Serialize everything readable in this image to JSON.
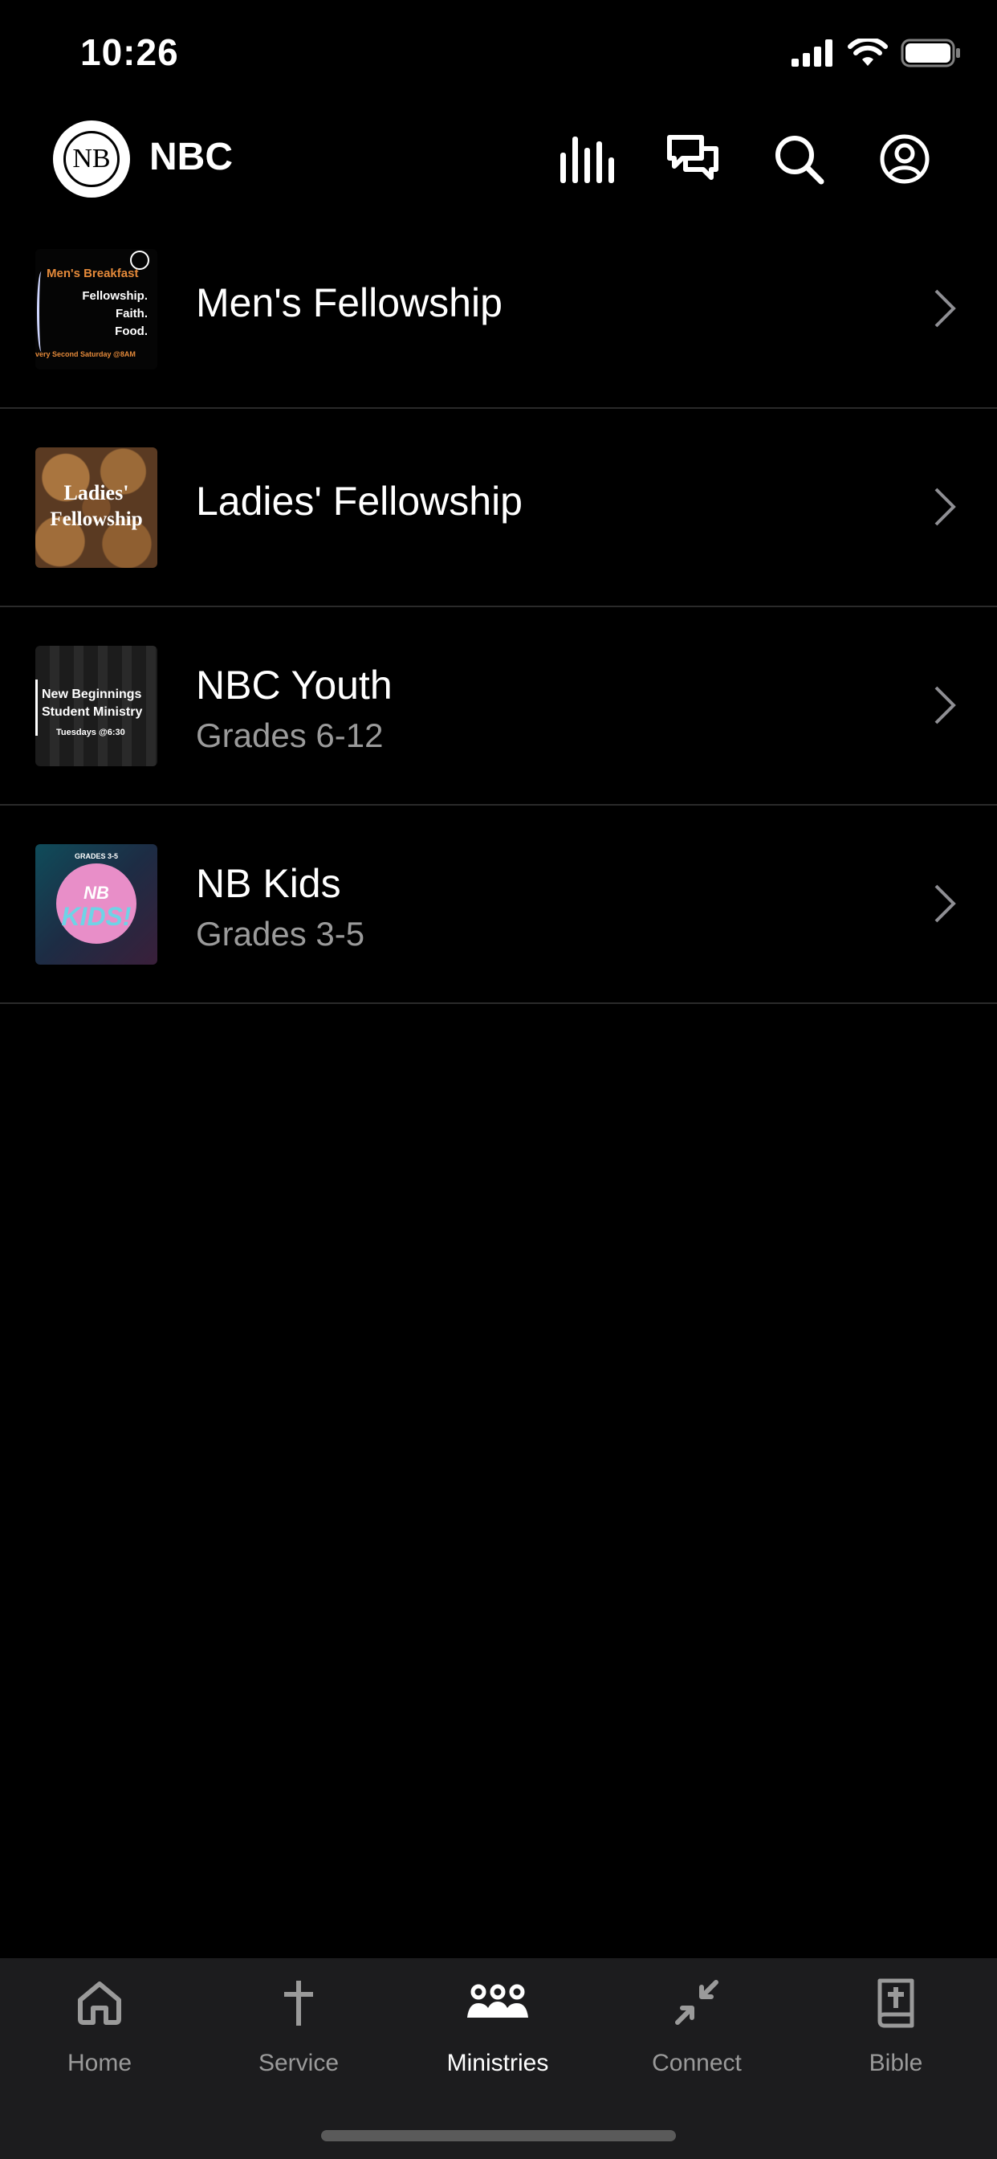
{
  "status_bar": {
    "time": "10:26"
  },
  "header": {
    "logo_text": "NB",
    "title": "NBC"
  },
  "list": [
    {
      "title": "Men's Fellowship",
      "subtitle": "",
      "thumb": {
        "line1": "Men's Breakfast",
        "line2": "Fellowship.",
        "line3": "Faith.",
        "line4": "Food.",
        "line5": "very Second Saturday @8AM"
      }
    },
    {
      "title": "Ladies' Fellowship",
      "subtitle": "",
      "thumb": {
        "line1": "Ladies'",
        "line2": "Fellowship"
      }
    },
    {
      "title": "NBC Youth",
      "subtitle": "Grades 6-12",
      "thumb": {
        "line1": "New Beginnings",
        "line2": "Student Ministry",
        "line3": "Tuesdays @6:30"
      }
    },
    {
      "title": "NB Kids",
      "subtitle": "Grades 3-5",
      "thumb": {
        "line1": "GRADES 3-5",
        "line2": "NB",
        "line3": "KIDS!"
      }
    }
  ],
  "tabs": [
    {
      "label": "Home",
      "icon": "home-icon"
    },
    {
      "label": "Service",
      "icon": "cross-icon"
    },
    {
      "label": "Ministries",
      "icon": "group-icon",
      "active": true
    },
    {
      "label": "Connect",
      "icon": "connect-icon"
    },
    {
      "label": "Bible",
      "icon": "bible-icon"
    }
  ],
  "colors": {
    "background": "#000000",
    "tabbar": "#1c1c1e",
    "inactive": "#9a9a9a",
    "accent": "#ffffff"
  }
}
